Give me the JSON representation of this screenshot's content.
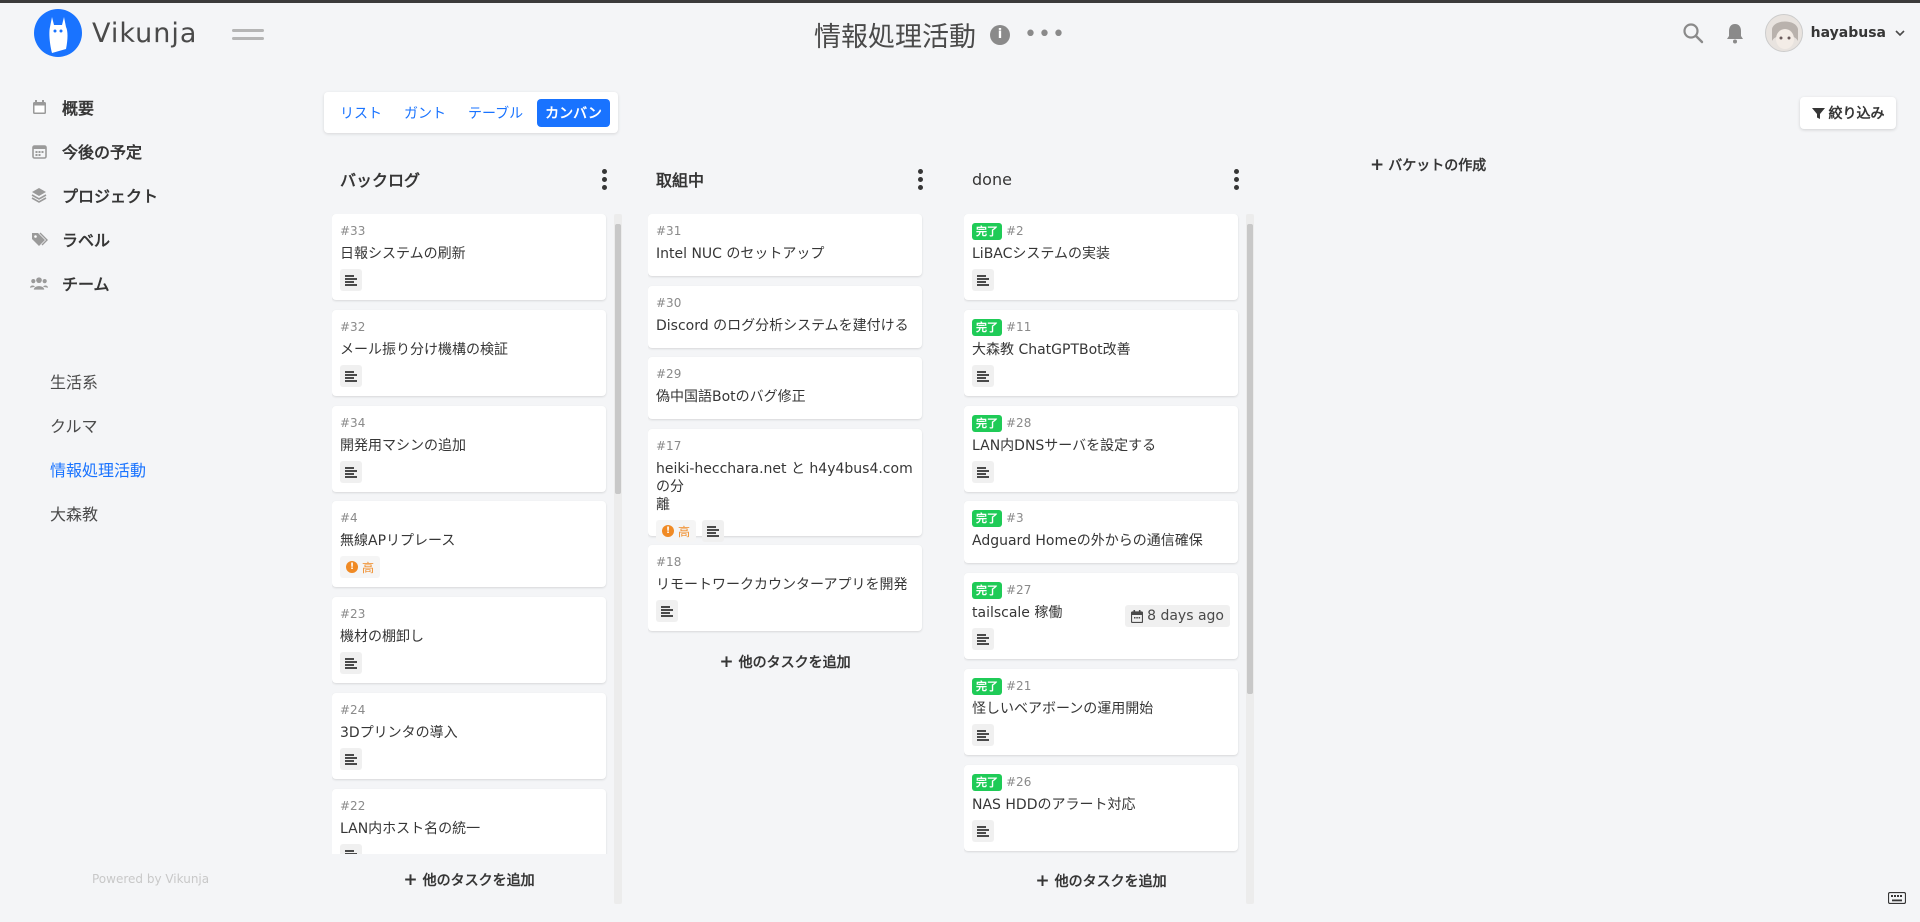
{
  "app": {
    "name": "Vikunja",
    "powered_by": "Powered by Vikunja"
  },
  "header": {
    "project_title": "情報処理活動",
    "info_icon": "i",
    "more_dots": "•••",
    "username": "hayabusa"
  },
  "sidebar": {
    "menu": [
      {
        "label": "概要",
        "icon": "calendar-icon"
      },
      {
        "label": "今後の予定",
        "icon": "calendar-grid-icon"
      },
      {
        "label": "プロジェクト",
        "icon": "layers-icon"
      },
      {
        "label": "ラベル",
        "icon": "tags-icon"
      },
      {
        "label": "チーム",
        "icon": "users-icon"
      }
    ],
    "projects": [
      {
        "label": "生活系"
      },
      {
        "label": "クルマ"
      },
      {
        "label": "情報処理活動"
      },
      {
        "label": "大森教"
      }
    ]
  },
  "views": {
    "list": "リスト",
    "gantt": "ガント",
    "table": "テーブル",
    "kanban": "カンバン",
    "active": "kanban"
  },
  "filter_label": "絞り込み",
  "add_task_label": "他のタスクを追加",
  "create_bucket_label": "バケットの作成",
  "colors": {
    "primary": "#1973ff",
    "done_badge": "#1fcb57",
    "priority_high": "#f08a24",
    "background": "#f4f5f7"
  },
  "buckets": [
    {
      "title": "バックログ",
      "cards": [
        {
          "id": "#33",
          "title": "日報システムの刷新",
          "has_description": true
        },
        {
          "id": "#32",
          "title": "メール振り分け機構の検証",
          "has_description": true
        },
        {
          "id": "#34",
          "title": "開発用マシンの追加",
          "has_description": true
        },
        {
          "id": "#4",
          "title": "無線APリプレース",
          "priority": "高",
          "has_description": false
        },
        {
          "id": "#23",
          "title": "機材の棚卸し",
          "has_description": true
        },
        {
          "id": "#24",
          "title": "3Dプリンタの導入",
          "has_description": true
        },
        {
          "id": "#22",
          "title": "LAN内ホスト名の統一",
          "has_description": true
        }
      ]
    },
    {
      "title": "取組中",
      "cards": [
        {
          "id": "#31",
          "title": "Intel NUC のセットアップ"
        },
        {
          "id": "#30",
          "title": "Discord のログ分析システムを建付ける"
        },
        {
          "id": "#29",
          "title": "偽中国語Botのバグ修正"
        },
        {
          "id": "#17",
          "title_line1": "heiki-hecchara.net と h4y4bus4.com の分",
          "title_line2": "離",
          "priority": "高",
          "has_description": true
        },
        {
          "id": "#18",
          "title": "リモートワークカウンターアプリを開発",
          "has_description": true
        }
      ]
    },
    {
      "title": "done",
      "done_label": "完了",
      "cards": [
        {
          "id": "#2",
          "title": "LiBACシステムの実装"
        },
        {
          "id": "#11",
          "title": "大森教 ChatGPTBot改善"
        },
        {
          "id": "#28",
          "title": "LAN内DNSサーバを設定する"
        },
        {
          "id": "#3",
          "title": "Adguard Homeの外からの通信確保"
        },
        {
          "id": "#27",
          "title": "tailscale 稼働",
          "due": "8 days ago"
        },
        {
          "id": "#21",
          "title": "怪しいベアボーンの運用開始"
        },
        {
          "id": "#26",
          "title": "NAS HDDのアラート対応"
        }
      ]
    }
  ]
}
